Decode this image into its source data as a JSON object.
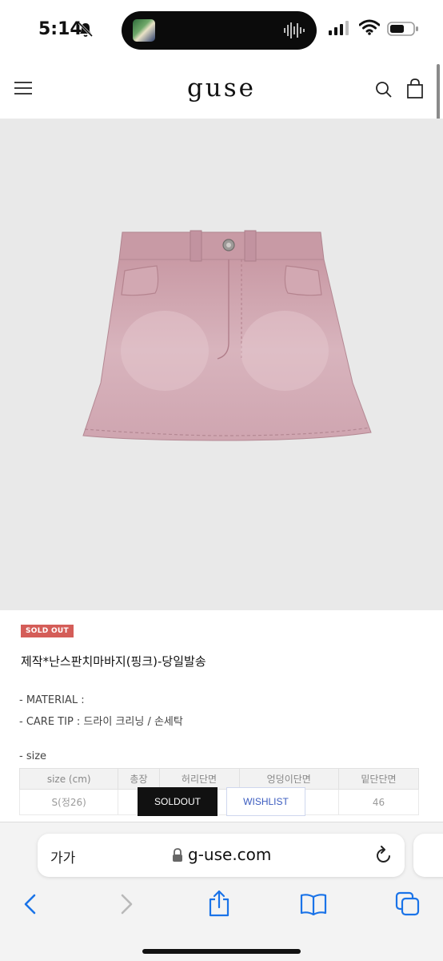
{
  "status": {
    "time": "5:14"
  },
  "header": {
    "logo": "guse"
  },
  "product": {
    "badge": "SOLD OUT",
    "name": "제작*난스판치마바지(핑크)-당일발송",
    "material": "- MATERIAL :",
    "care_tip": "- CARE TIP : 드라이 크리닝 / 손세탁",
    "size_label": "- size"
  },
  "size_table": {
    "headers": [
      "size (cm)",
      "총장",
      "허리단면",
      "엉덩이단면",
      "밑단단면"
    ],
    "rows": [
      [
        "S(정26)",
        "",
        "",
        "",
        "46"
      ]
    ]
  },
  "actions": {
    "soldout": "SOLDOUT",
    "wishlist": "WISHLIST"
  },
  "browser": {
    "text_size_label": "가가",
    "url": "g-use.com"
  },
  "colors": {
    "badge": "#d45d58",
    "soldout_button": "#111111",
    "wishlist_text": "#3a5bbf",
    "link_blue": "#1a73e8"
  }
}
